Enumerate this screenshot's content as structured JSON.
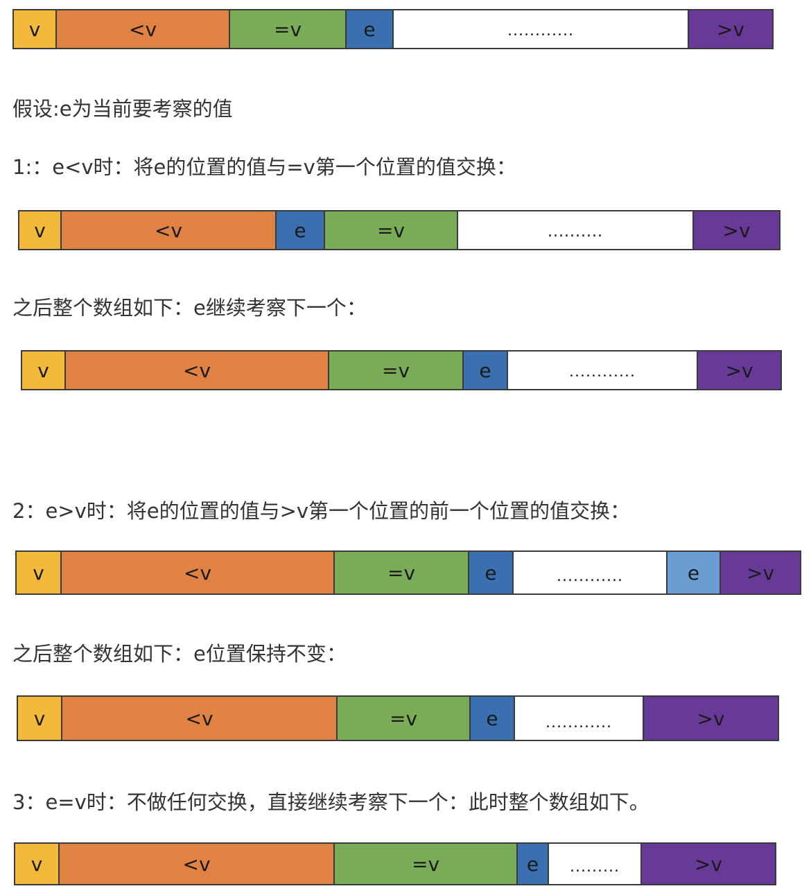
{
  "colors": {
    "v": "#f2b93b",
    "lt": "#e08243",
    "eq": "#7aab56",
    "e": "#3b70b0",
    "e_light": "#6a9ed2",
    "dots": "#ffffff",
    "gt": "#673a98"
  },
  "labels": {
    "v": "v",
    "lt": "<v",
    "eq": "=v",
    "e": "e",
    "dots12": "............",
    "dots10": "..........",
    "dots9": ".........",
    "gt": ">v"
  },
  "texts": {
    "assume": "假设:e为当前要考察的值",
    "case1": "1:：e<v时：将e的位置的值与=v第一个位置的值交换：",
    "after1": "之后整个数组如下：e继续考察下一个：",
    "case2": "2：e>v时：将e的位置的值与>v第一个位置的前一个位置的值交换：",
    "after2": "之后整个数组如下：e位置保持不变：",
    "case3": "3：e=v时：不做任何交换，直接继续考察下一个：此时整个数组如下。"
  }
}
